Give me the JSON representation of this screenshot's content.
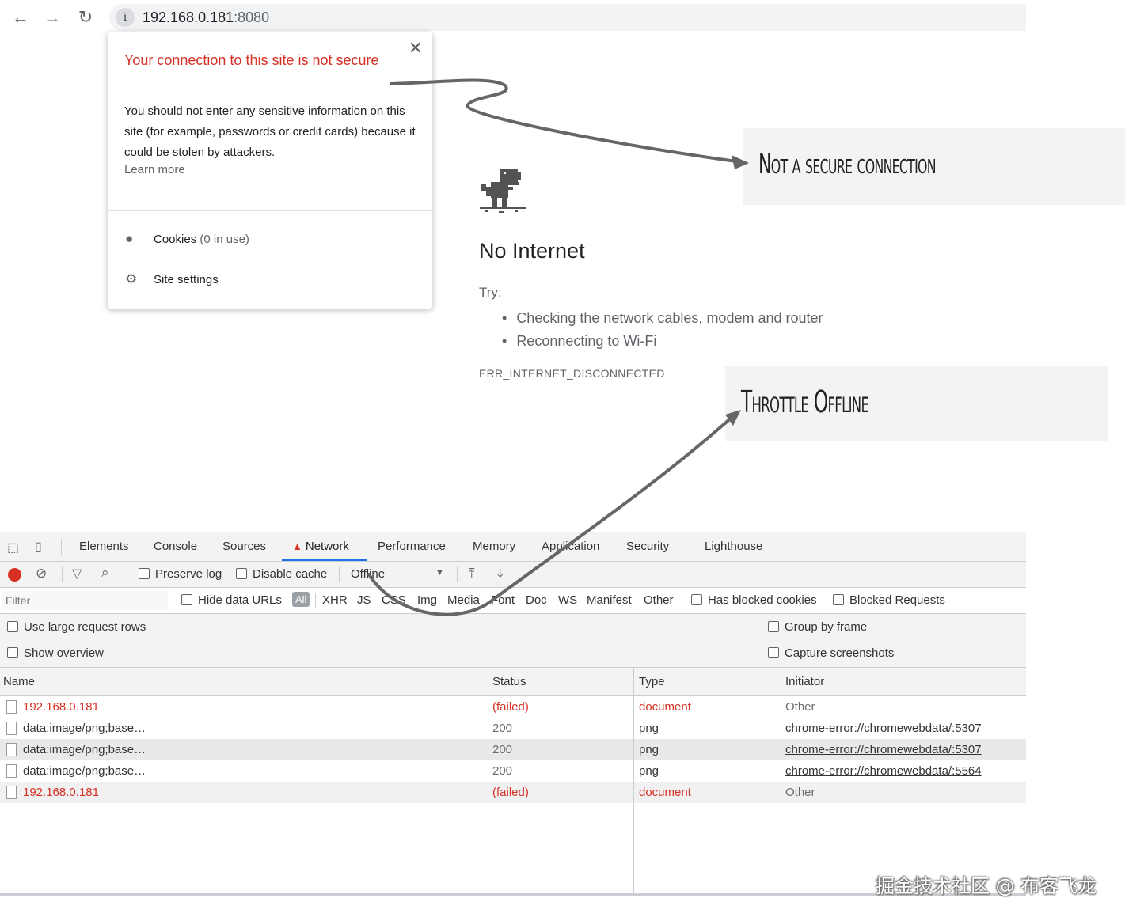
{
  "browser": {
    "url_host": "192.168.0.181",
    "url_port": ":8080",
    "info_icon": "info-icon"
  },
  "popup": {
    "title": "Your connection to this site is not secure",
    "description": "You should not enter any sensitive information on this site (for example, passwords or credit cards) because it could be stolen by attackers.",
    "learn_more": "Learn more",
    "cookies_label": "Cookies",
    "cookies_count": "(0 in use)",
    "site_settings": "Site settings"
  },
  "offline": {
    "title": "No Internet",
    "try": "Try:",
    "suggestions": [
      "Checking the network cables, modem and router",
      "Reconnecting to Wi-Fi"
    ],
    "code": "ERR_INTERNET_DISCONNECTED"
  },
  "annotations": {
    "secure": "Not a secure connection",
    "throttle": "Throttle Offline"
  },
  "devtools": {
    "tabs": [
      "Elements",
      "Console",
      "Sources",
      "Network",
      "Performance",
      "Memory",
      "Application",
      "Security",
      "Lighthouse"
    ],
    "active_tab": "Network",
    "toolbar": {
      "preserve_log": "Preserve log",
      "disable_cache": "Disable cache",
      "throttle": "Offline"
    },
    "filter": {
      "placeholder": "Filter",
      "hide_data_urls": "Hide data URLs",
      "all": "All",
      "types": [
        "XHR",
        "JS",
        "CSS",
        "Img",
        "Media",
        "Font",
        "Doc",
        "WS",
        "Manifest",
        "Other"
      ],
      "has_blocked_cookies": "Has blocked cookies",
      "blocked_requests": "Blocked Requests"
    },
    "options": {
      "large_rows": "Use large request rows",
      "show_overview": "Show overview",
      "group_by_frame": "Group by frame",
      "capture_screenshots": "Capture screenshots"
    },
    "columns": [
      "Name",
      "Status",
      "Type",
      "Initiator"
    ],
    "rows": [
      {
        "name": "192.168.0.181",
        "status": "(failed)",
        "type": "document",
        "initiator": "Other"
      },
      {
        "name": "data:image/png;base…",
        "status": "200",
        "type": "png",
        "initiator": "chrome-error://chromewebdata/:5307"
      },
      {
        "name": "data:image/png;base…",
        "status": "200",
        "type": "png",
        "initiator": "chrome-error://chromewebdata/:5307"
      },
      {
        "name": "data:image/png;base…",
        "status": "200",
        "type": "png",
        "initiator": "chrome-error://chromewebdata/:5564"
      },
      {
        "name": "192.168.0.181",
        "status": "(failed)",
        "type": "document",
        "initiator": "Other"
      }
    ]
  },
  "watermark": "掘金技术社区 @ 布客飞龙",
  "colors": {
    "error": "#d93025",
    "accent": "#1a73e8"
  }
}
